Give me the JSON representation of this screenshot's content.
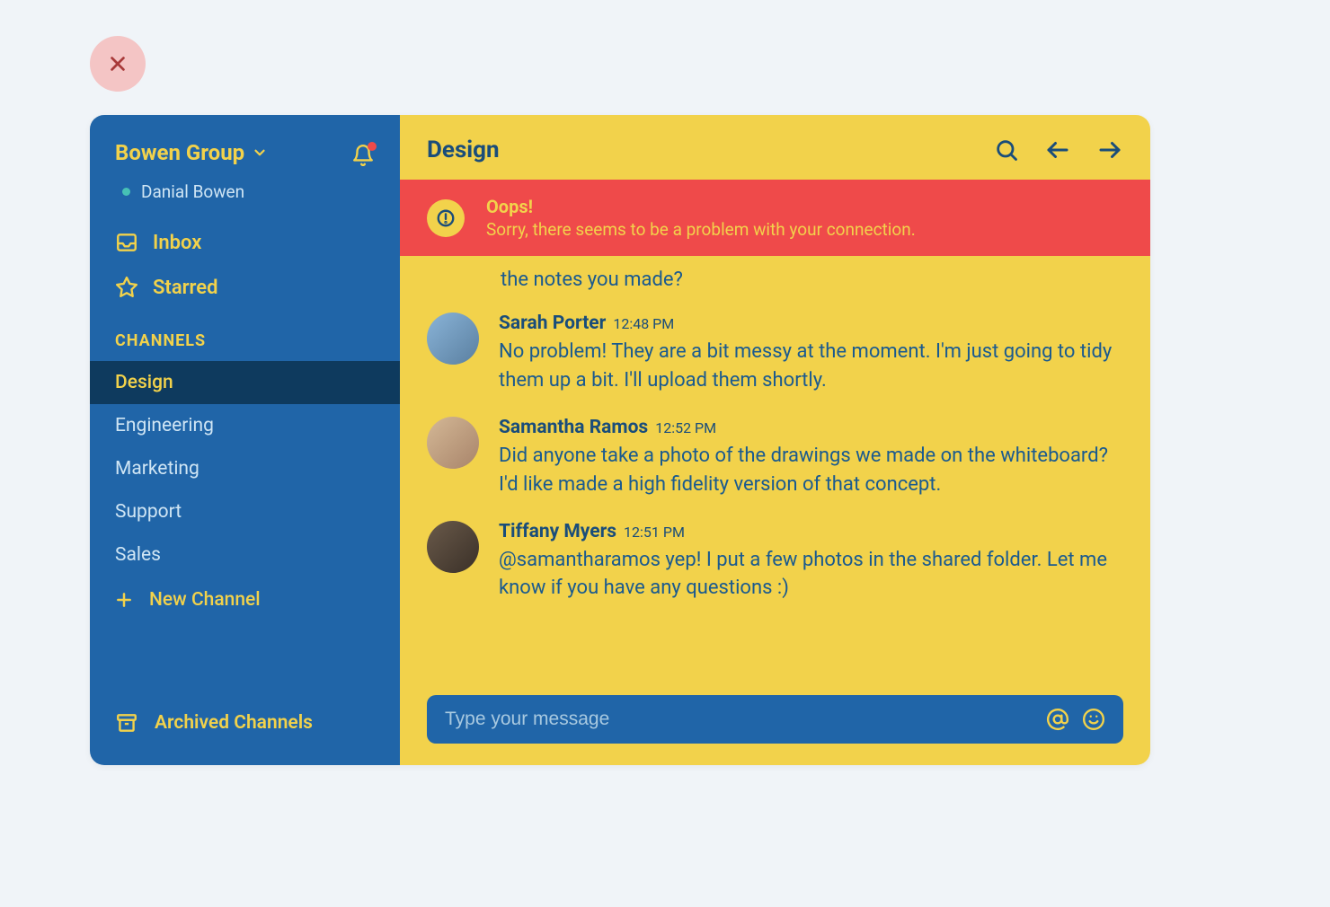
{
  "workspace": {
    "name": "Bowen Group",
    "user": "Danial Bowen"
  },
  "nav": {
    "inbox": "Inbox",
    "starred": "Starred",
    "channelsLabel": "CHANNELS",
    "newChannel": "New Channel",
    "archived": "Archived Channels"
  },
  "channels": [
    {
      "name": "Design",
      "active": true
    },
    {
      "name": "Engineering",
      "active": false
    },
    {
      "name": "Marketing",
      "active": false
    },
    {
      "name": "Support",
      "active": false
    },
    {
      "name": "Sales",
      "active": false
    }
  ],
  "main": {
    "title": "Design"
  },
  "error": {
    "title": "Oops!",
    "body": "Sorry, there seems to be a problem with your connection."
  },
  "partialMessage": "the notes you made?",
  "messages": [
    {
      "author": "Sarah Porter",
      "time": "12:48 PM",
      "text": "No problem! They are a bit messy at the moment. I'm just going to tidy them up a bit. I'll upload them shortly."
    },
    {
      "author": "Samantha Ramos",
      "time": "12:52 PM",
      "text": "Did anyone take a photo of the drawings we made on the whiteboard? I'd like made a high fidelity version of that concept."
    },
    {
      "author": "Tiffany Myers",
      "time": "12:51 PM",
      "text": "@samantharamos yep! I put a few photos in the shared folder. Let me know if you have any questions :)"
    }
  ],
  "composer": {
    "placeholder": "Type your message"
  },
  "colors": {
    "sidebarBg": "#2065a8",
    "accent": "#f2d24b",
    "error": "#ef4a4a",
    "textDark": "#1a4d7a"
  }
}
